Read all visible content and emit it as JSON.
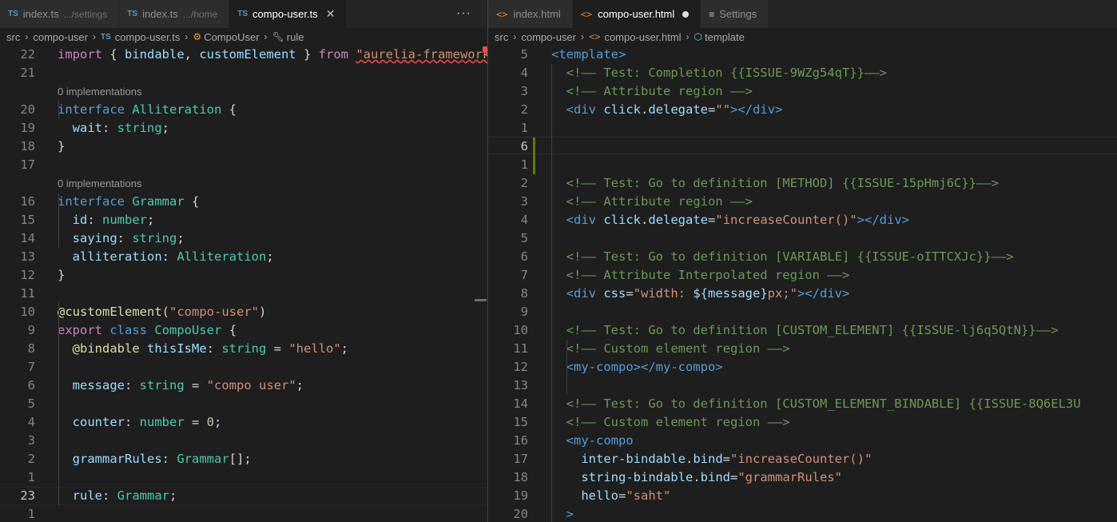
{
  "left": {
    "tabs": [
      {
        "icon": "TS",
        "label": "index.ts",
        "desc": ".../settings",
        "active": false
      },
      {
        "icon": "TS",
        "label": "index.ts",
        "desc": ".../home",
        "active": false
      },
      {
        "icon": "TS",
        "label": "compo-user.ts",
        "desc": "",
        "active": true
      }
    ],
    "more": "···",
    "breadcrumb": {
      "folder1": "src",
      "file": "compo-user.ts",
      "symbol1": "CompoUser",
      "symbol2": "rule"
    },
    "codelens": "0 implementations",
    "lines": [
      {
        "num": "22",
        "tokens": [
          [
            "kwc",
            "import"
          ],
          [
            "punct",
            " { "
          ],
          [
            "prop",
            "bindable"
          ],
          [
            "punct",
            ", "
          ],
          [
            "prop",
            "customElement"
          ],
          [
            "punct",
            " } "
          ],
          [
            "kwc",
            "from"
          ],
          [
            "punct",
            " "
          ],
          [
            "str squiggle",
            "\"aurelia-framework\""
          ],
          [
            "punct",
            ";"
          ]
        ]
      },
      {
        "num": "21",
        "tokens": []
      },
      {
        "num": "20",
        "tokens": [
          [
            "kw",
            "interface"
          ],
          [
            "punct",
            " "
          ],
          [
            "type",
            "Alliteration"
          ],
          [
            "punct",
            " {"
          ]
        ],
        "lens": true
      },
      {
        "num": "19",
        "tokens": [
          [
            "punct",
            "  "
          ],
          [
            "prop",
            "wait"
          ],
          [
            "punct",
            ": "
          ],
          [
            "type",
            "string"
          ],
          [
            "punct",
            ";"
          ]
        ]
      },
      {
        "num": "18",
        "tokens": [
          [
            "punct",
            "}"
          ]
        ]
      },
      {
        "num": "17",
        "tokens": []
      },
      {
        "num": "16",
        "tokens": [
          [
            "kw",
            "interface"
          ],
          [
            "punct",
            " "
          ],
          [
            "type",
            "Grammar"
          ],
          [
            "punct",
            " {"
          ]
        ],
        "lens": true
      },
      {
        "num": "15",
        "tokens": [
          [
            "punct",
            "  "
          ],
          [
            "prop",
            "id"
          ],
          [
            "punct",
            ": "
          ],
          [
            "type",
            "number"
          ],
          [
            "punct",
            ";"
          ]
        ]
      },
      {
        "num": "14",
        "tokens": [
          [
            "punct",
            "  "
          ],
          [
            "prop",
            "saying"
          ],
          [
            "punct",
            ": "
          ],
          [
            "type",
            "string"
          ],
          [
            "punct",
            ";"
          ]
        ]
      },
      {
        "num": "13",
        "tokens": [
          [
            "punct",
            "  "
          ],
          [
            "prop",
            "alliteration"
          ],
          [
            "punct",
            ": "
          ],
          [
            "type",
            "Alliteration"
          ],
          [
            "punct",
            ";"
          ]
        ]
      },
      {
        "num": "12",
        "tokens": [
          [
            "punct",
            "}"
          ]
        ]
      },
      {
        "num": "11",
        "tokens": []
      },
      {
        "num": "10",
        "tokens": [
          [
            "dec",
            "@customElement"
          ],
          [
            "punct",
            "("
          ],
          [
            "str",
            "\"compo-user\""
          ],
          [
            "punct",
            ")"
          ]
        ]
      },
      {
        "num": "9",
        "tokens": [
          [
            "kwc",
            "export"
          ],
          [
            "punct",
            " "
          ],
          [
            "kw",
            "class"
          ],
          [
            "punct",
            " "
          ],
          [
            "type",
            "CompoUser"
          ],
          [
            "punct",
            " {"
          ]
        ]
      },
      {
        "num": "8",
        "tokens": [
          [
            "punct",
            "  "
          ],
          [
            "dec",
            "@bindable"
          ],
          [
            "punct",
            " "
          ],
          [
            "prop",
            "thisIsMe"
          ],
          [
            "punct",
            ": "
          ],
          [
            "type",
            "string"
          ],
          [
            "punct",
            " = "
          ],
          [
            "str",
            "\"hello\""
          ],
          [
            "punct",
            ";"
          ]
        ]
      },
      {
        "num": "7",
        "tokens": []
      },
      {
        "num": "6",
        "tokens": [
          [
            "punct",
            "  "
          ],
          [
            "prop",
            "message"
          ],
          [
            "punct",
            ": "
          ],
          [
            "type",
            "string"
          ],
          [
            "punct",
            " = "
          ],
          [
            "str",
            "\"compo user\""
          ],
          [
            "punct",
            ";"
          ]
        ]
      },
      {
        "num": "5",
        "tokens": []
      },
      {
        "num": "4",
        "tokens": [
          [
            "punct",
            "  "
          ],
          [
            "prop",
            "counter"
          ],
          [
            "punct",
            ": "
          ],
          [
            "type",
            "number"
          ],
          [
            "punct",
            " = "
          ],
          [
            "num",
            "0"
          ],
          [
            "punct",
            ";"
          ]
        ]
      },
      {
        "num": "3",
        "tokens": []
      },
      {
        "num": "2",
        "tokens": [
          [
            "punct",
            "  "
          ],
          [
            "prop",
            "grammarRules"
          ],
          [
            "punct",
            ": "
          ],
          [
            "type",
            "Grammar"
          ],
          [
            "punct",
            "[];"
          ]
        ]
      },
      {
        "num": "1",
        "tokens": []
      },
      {
        "num": "23",
        "tokens": [
          [
            "punct",
            "  "
          ],
          [
            "prop",
            "rule"
          ],
          [
            "punct",
            ": "
          ],
          [
            "type",
            "Grammar"
          ],
          [
            "punct",
            ";"
          ]
        ],
        "current": true
      },
      {
        "num": "1",
        "tokens": []
      }
    ]
  },
  "right": {
    "tabs": [
      {
        "icon": "<>",
        "label": "index.html",
        "active": false,
        "dirty": false
      },
      {
        "icon": "<>",
        "label": "compo-user.html",
        "active": true,
        "dirty": true
      },
      {
        "icon": "≡",
        "label": "Settings",
        "active": false,
        "dirty": false
      }
    ],
    "breadcrumb": {
      "folder1": "src",
      "folder2": "compo-user",
      "file": "compo-user.html",
      "symbol": "template"
    },
    "cursor": "I",
    "lines": [
      {
        "num": "5",
        "tokens": [
          [
            "tag",
            "<template"
          ],
          [
            "tag",
            ">"
          ]
        ]
      },
      {
        "num": "4",
        "tokens": [
          [
            "punct",
            "  "
          ],
          [
            "cmt",
            "<!—— Test: Completion {{ISSUE-9WZg54qT}}——>"
          ]
        ]
      },
      {
        "num": "3",
        "tokens": [
          [
            "punct",
            "  "
          ],
          [
            "cmt",
            "<!—— Attribute region ——>"
          ]
        ]
      },
      {
        "num": "2",
        "tokens": [
          [
            "punct",
            "  "
          ],
          [
            "tag",
            "<div"
          ],
          [
            "punct",
            " "
          ],
          [
            "attr",
            "click"
          ],
          [
            "punct",
            "."
          ],
          [
            "attr",
            "delegate"
          ],
          [
            "punct",
            "="
          ],
          [
            "str",
            "\"\""
          ],
          [
            "tag",
            "></div>"
          ]
        ]
      },
      {
        "num": "1",
        "tokens": []
      },
      {
        "num": "6",
        "tokens": [],
        "current": true
      },
      {
        "num": "1",
        "tokens": []
      },
      {
        "num": "2",
        "tokens": [
          [
            "punct",
            "  "
          ],
          [
            "cmt",
            "<!—— Test: Go to definition [METHOD] {{ISSUE-15pHmj6C}}——>"
          ]
        ]
      },
      {
        "num": "3",
        "tokens": [
          [
            "punct",
            "  "
          ],
          [
            "cmt",
            "<!—— Attribute region ——>"
          ]
        ]
      },
      {
        "num": "4",
        "tokens": [
          [
            "punct",
            "  "
          ],
          [
            "tag",
            "<div"
          ],
          [
            "punct",
            " "
          ],
          [
            "attr",
            "click"
          ],
          [
            "punct",
            "."
          ],
          [
            "attr",
            "delegate"
          ],
          [
            "punct",
            "="
          ],
          [
            "str",
            "\"increaseCounter()\""
          ],
          [
            "tag",
            "></div>"
          ]
        ]
      },
      {
        "num": "5",
        "tokens": []
      },
      {
        "num": "6",
        "tokens": [
          [
            "punct",
            "  "
          ],
          [
            "cmt",
            "<!—— Test: Go to definition [VARIABLE] {{ISSUE-oITTCXJc}}——>"
          ]
        ]
      },
      {
        "num": "7",
        "tokens": [
          [
            "punct",
            "  "
          ],
          [
            "cmt",
            "<!—— Attribute Interpolated region ——>"
          ]
        ]
      },
      {
        "num": "8",
        "tokens": [
          [
            "punct",
            "  "
          ],
          [
            "tag",
            "<div"
          ],
          [
            "punct",
            " "
          ],
          [
            "attr",
            "css"
          ],
          [
            "punct",
            "="
          ],
          [
            "str",
            "\"width: "
          ],
          [
            "prop",
            "${message}"
          ],
          [
            "str",
            "px;\""
          ],
          [
            "tag",
            "></div>"
          ]
        ]
      },
      {
        "num": "9",
        "tokens": []
      },
      {
        "num": "10",
        "tokens": [
          [
            "punct",
            "  "
          ],
          [
            "cmt",
            "<!—— Test: Go to definition [CUSTOM_ELEMENT] {{ISSUE-lj6q5QtN}}——>"
          ]
        ]
      },
      {
        "num": "11",
        "tokens": [
          [
            "punct",
            "  "
          ],
          [
            "cmt",
            "<!—— Custom element region ——>"
          ]
        ]
      },
      {
        "num": "12",
        "tokens": [
          [
            "punct",
            "  "
          ],
          [
            "tag",
            "<my-compo></my-compo>"
          ]
        ]
      },
      {
        "num": "13",
        "tokens": []
      },
      {
        "num": "14",
        "tokens": [
          [
            "punct",
            "  "
          ],
          [
            "cmt",
            "<!—— Test: Go to definition [CUSTOM_ELEMENT_BINDABLE] {{ISSUE-8Q6EL3U"
          ]
        ]
      },
      {
        "num": "15",
        "tokens": [
          [
            "punct",
            "  "
          ],
          [
            "cmt",
            "<!—— Custom element region ——>"
          ]
        ]
      },
      {
        "num": "16",
        "tokens": [
          [
            "punct",
            "  "
          ],
          [
            "tag",
            "<my-compo"
          ]
        ]
      },
      {
        "num": "17",
        "tokens": [
          [
            "punct",
            "    "
          ],
          [
            "attr",
            "inter-bindable"
          ],
          [
            "punct",
            "."
          ],
          [
            "attr",
            "bind"
          ],
          [
            "punct",
            "="
          ],
          [
            "str",
            "\"increaseCounter()\""
          ]
        ]
      },
      {
        "num": "18",
        "tokens": [
          [
            "punct",
            "    "
          ],
          [
            "attr",
            "string-bindable"
          ],
          [
            "punct",
            "."
          ],
          [
            "attr",
            "bind"
          ],
          [
            "punct",
            "="
          ],
          [
            "str",
            "\"grammarRules\""
          ]
        ]
      },
      {
        "num": "19",
        "tokens": [
          [
            "punct",
            "    "
          ],
          [
            "attr",
            "hello"
          ],
          [
            "punct",
            "="
          ],
          [
            "str",
            "\"saht\""
          ]
        ]
      },
      {
        "num": "20",
        "tokens": [
          [
            "punct",
            "  "
          ],
          [
            "tag",
            ">"
          ]
        ]
      }
    ]
  }
}
